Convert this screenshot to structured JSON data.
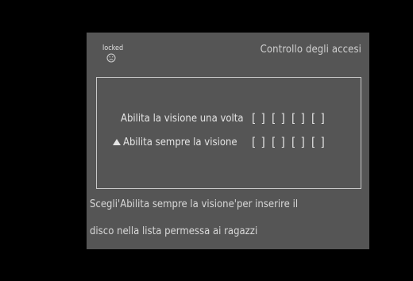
{
  "screen": {
    "lock_label": "locked",
    "title": "Controllo degli accesi"
  },
  "options": [
    {
      "label": "Abilita la visione una volta",
      "slots": [
        "[ ]",
        "[ ]",
        "[ ]",
        "[ ]"
      ],
      "selected": false
    },
    {
      "label": "Abilita sempre la visione",
      "slots": [
        "[ ]",
        "[ ]",
        "[ ]",
        "[ ]"
      ],
      "selected": true
    }
  ],
  "hint": {
    "line1": "Scegli'Abilita sempre la visione'per inserire il",
    "line2": "disco nella lista permessa ai ragazzi"
  },
  "colors": {
    "background": "#000000",
    "panel": "#555555",
    "text": "#e4e4e4",
    "border": "#c8c8c8"
  }
}
